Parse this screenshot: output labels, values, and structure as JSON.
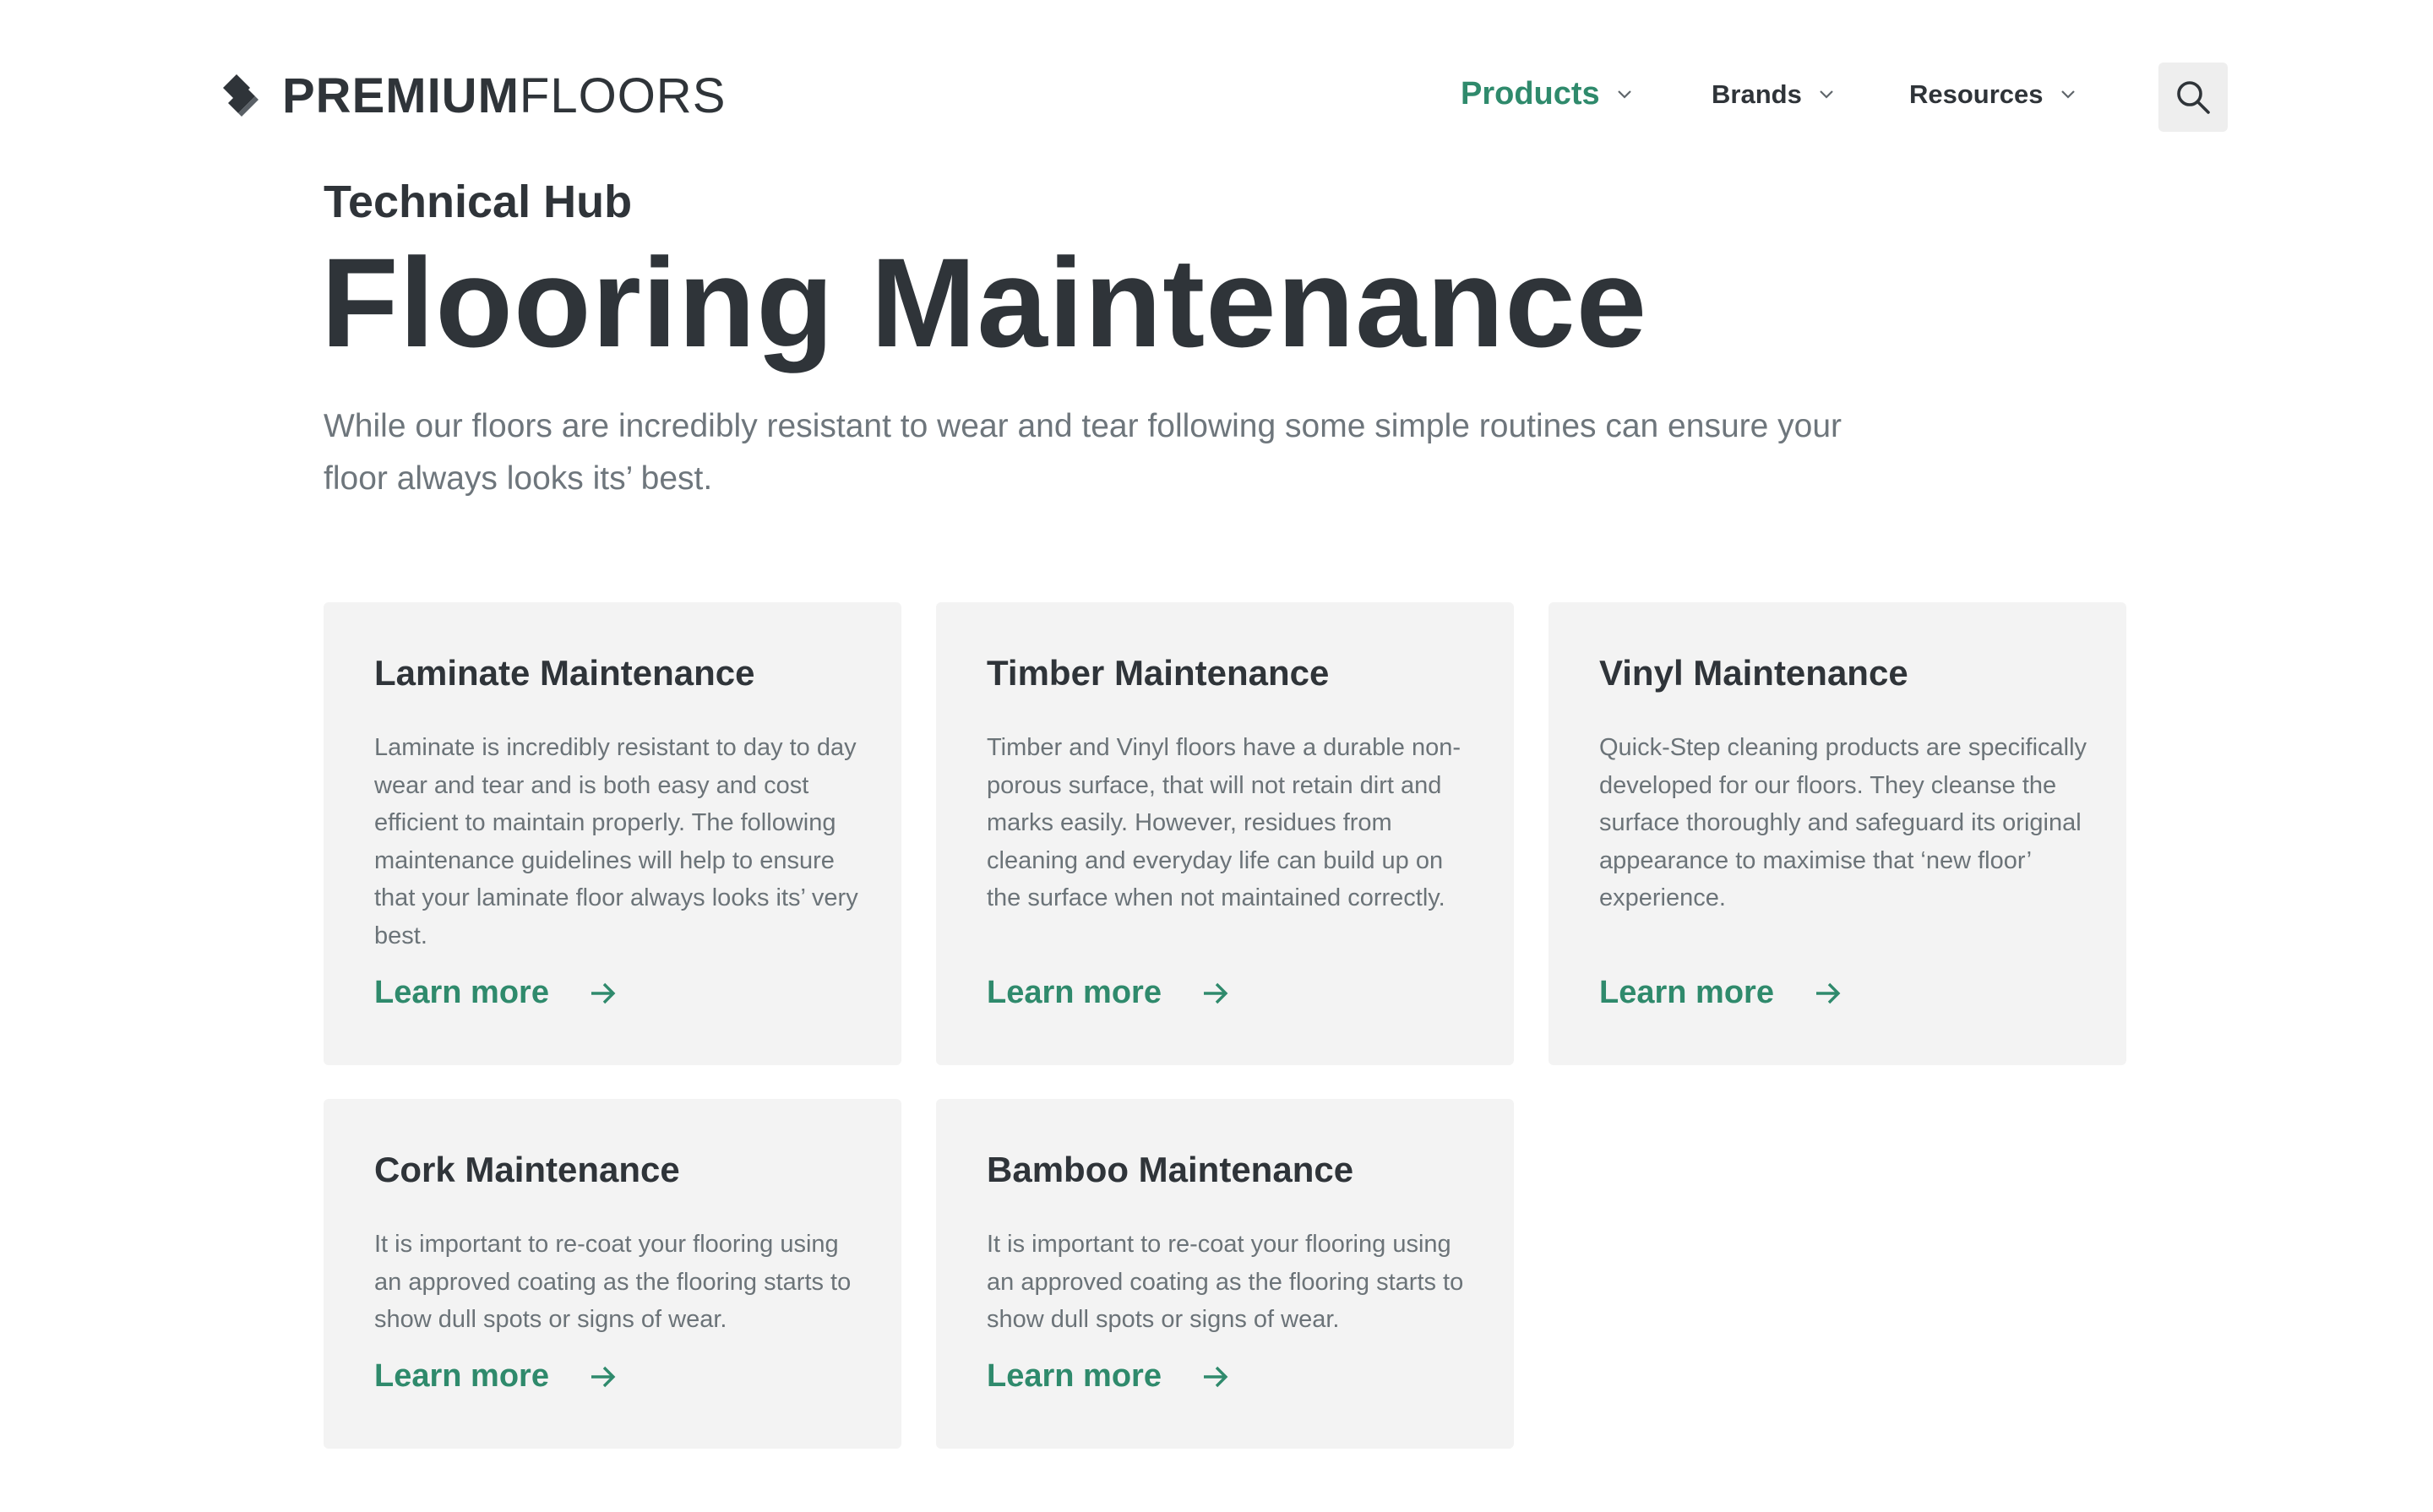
{
  "header": {
    "logo": {
      "strong": "PREMIUM",
      "light": "FLOORS"
    },
    "nav": [
      {
        "label": "Products"
      },
      {
        "label": "Brands"
      },
      {
        "label": "Resources"
      }
    ]
  },
  "hero": {
    "eyebrow": "Technical Hub",
    "title": "Flooring Maintenance",
    "intro": "While our floors are incredibly resistant to wear and tear following some simple routines can ensure your floor always looks its’ best."
  },
  "cards": [
    {
      "title": "Laminate Maintenance",
      "body": "Laminate is incredibly resistant to day to day wear and tear and is both easy and cost efficient to maintain properly. The following maintenance guidelines will help to ensure that your laminate floor always looks its’ very best.",
      "link": "Learn more"
    },
    {
      "title": "Timber Maintenance",
      "body": "Timber and Vinyl floors have a durable non-porous surface, that will not retain dirt and marks easily. However, residues from cleaning and everyday life can build up on the surface when not maintained correctly.",
      "link": "Learn more"
    },
    {
      "title": "Vinyl Maintenance",
      "body": "Quick-Step cleaning products are specifically developed for our floors. They cleanse the surface thoroughly and safeguard its original appearance to maximise that ‘new floor’ experience.",
      "link": "Learn more"
    },
    {
      "title": "Cork Maintenance",
      "body": "It is important to re-coat your flooring using an approved coating as the flooring starts to show dull spots or signs of wear.",
      "link": "Learn more"
    },
    {
      "title": "Bamboo Maintenance",
      "body": "It is important to re-coat your flooring using an approved coating as the flooring starts to show dull spots or signs of wear.",
      "link": "Learn more"
    }
  ],
  "colors": {
    "accent": "#2f8a6c",
    "text": "#2f3439",
    "muted": "#6e767c",
    "card_bg": "#f3f3f3"
  },
  "icons": [
    "logo-mark-icon",
    "chevron-down-icon",
    "search-icon",
    "arrow-right-icon"
  ]
}
